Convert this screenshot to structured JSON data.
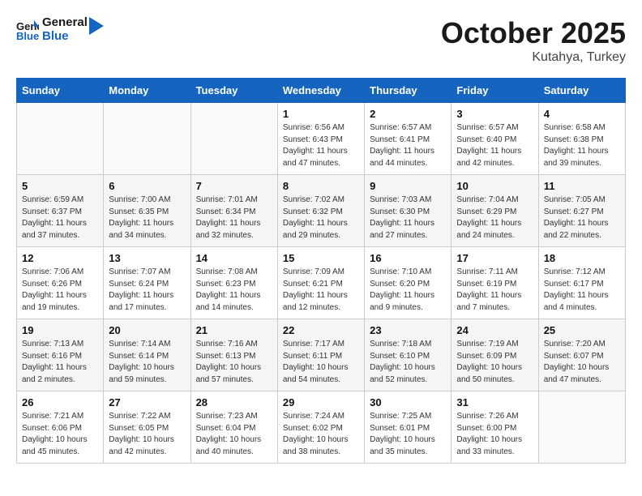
{
  "header": {
    "logo_line1": "General",
    "logo_line2": "Blue",
    "month": "October 2025",
    "location": "Kutahya, Turkey"
  },
  "weekdays": [
    "Sunday",
    "Monday",
    "Tuesday",
    "Wednesday",
    "Thursday",
    "Friday",
    "Saturday"
  ],
  "weeks": [
    [
      {
        "day": "",
        "info": ""
      },
      {
        "day": "",
        "info": ""
      },
      {
        "day": "",
        "info": ""
      },
      {
        "day": "1",
        "info": "Sunrise: 6:56 AM\nSunset: 6:43 PM\nDaylight: 11 hours\nand 47 minutes."
      },
      {
        "day": "2",
        "info": "Sunrise: 6:57 AM\nSunset: 6:41 PM\nDaylight: 11 hours\nand 44 minutes."
      },
      {
        "day": "3",
        "info": "Sunrise: 6:57 AM\nSunset: 6:40 PM\nDaylight: 11 hours\nand 42 minutes."
      },
      {
        "day": "4",
        "info": "Sunrise: 6:58 AM\nSunset: 6:38 PM\nDaylight: 11 hours\nand 39 minutes."
      }
    ],
    [
      {
        "day": "5",
        "info": "Sunrise: 6:59 AM\nSunset: 6:37 PM\nDaylight: 11 hours\nand 37 minutes."
      },
      {
        "day": "6",
        "info": "Sunrise: 7:00 AM\nSunset: 6:35 PM\nDaylight: 11 hours\nand 34 minutes."
      },
      {
        "day": "7",
        "info": "Sunrise: 7:01 AM\nSunset: 6:34 PM\nDaylight: 11 hours\nand 32 minutes."
      },
      {
        "day": "8",
        "info": "Sunrise: 7:02 AM\nSunset: 6:32 PM\nDaylight: 11 hours\nand 29 minutes."
      },
      {
        "day": "9",
        "info": "Sunrise: 7:03 AM\nSunset: 6:30 PM\nDaylight: 11 hours\nand 27 minutes."
      },
      {
        "day": "10",
        "info": "Sunrise: 7:04 AM\nSunset: 6:29 PM\nDaylight: 11 hours\nand 24 minutes."
      },
      {
        "day": "11",
        "info": "Sunrise: 7:05 AM\nSunset: 6:27 PM\nDaylight: 11 hours\nand 22 minutes."
      }
    ],
    [
      {
        "day": "12",
        "info": "Sunrise: 7:06 AM\nSunset: 6:26 PM\nDaylight: 11 hours\nand 19 minutes."
      },
      {
        "day": "13",
        "info": "Sunrise: 7:07 AM\nSunset: 6:24 PM\nDaylight: 11 hours\nand 17 minutes."
      },
      {
        "day": "14",
        "info": "Sunrise: 7:08 AM\nSunset: 6:23 PM\nDaylight: 11 hours\nand 14 minutes."
      },
      {
        "day": "15",
        "info": "Sunrise: 7:09 AM\nSunset: 6:21 PM\nDaylight: 11 hours\nand 12 minutes."
      },
      {
        "day": "16",
        "info": "Sunrise: 7:10 AM\nSunset: 6:20 PM\nDaylight: 11 hours\nand 9 minutes."
      },
      {
        "day": "17",
        "info": "Sunrise: 7:11 AM\nSunset: 6:19 PM\nDaylight: 11 hours\nand 7 minutes."
      },
      {
        "day": "18",
        "info": "Sunrise: 7:12 AM\nSunset: 6:17 PM\nDaylight: 11 hours\nand 4 minutes."
      }
    ],
    [
      {
        "day": "19",
        "info": "Sunrise: 7:13 AM\nSunset: 6:16 PM\nDaylight: 11 hours\nand 2 minutes."
      },
      {
        "day": "20",
        "info": "Sunrise: 7:14 AM\nSunset: 6:14 PM\nDaylight: 10 hours\nand 59 minutes."
      },
      {
        "day": "21",
        "info": "Sunrise: 7:16 AM\nSunset: 6:13 PM\nDaylight: 10 hours\nand 57 minutes."
      },
      {
        "day": "22",
        "info": "Sunrise: 7:17 AM\nSunset: 6:11 PM\nDaylight: 10 hours\nand 54 minutes."
      },
      {
        "day": "23",
        "info": "Sunrise: 7:18 AM\nSunset: 6:10 PM\nDaylight: 10 hours\nand 52 minutes."
      },
      {
        "day": "24",
        "info": "Sunrise: 7:19 AM\nSunset: 6:09 PM\nDaylight: 10 hours\nand 50 minutes."
      },
      {
        "day": "25",
        "info": "Sunrise: 7:20 AM\nSunset: 6:07 PM\nDaylight: 10 hours\nand 47 minutes."
      }
    ],
    [
      {
        "day": "26",
        "info": "Sunrise: 7:21 AM\nSunset: 6:06 PM\nDaylight: 10 hours\nand 45 minutes."
      },
      {
        "day": "27",
        "info": "Sunrise: 7:22 AM\nSunset: 6:05 PM\nDaylight: 10 hours\nand 42 minutes."
      },
      {
        "day": "28",
        "info": "Sunrise: 7:23 AM\nSunset: 6:04 PM\nDaylight: 10 hours\nand 40 minutes."
      },
      {
        "day": "29",
        "info": "Sunrise: 7:24 AM\nSunset: 6:02 PM\nDaylight: 10 hours\nand 38 minutes."
      },
      {
        "day": "30",
        "info": "Sunrise: 7:25 AM\nSunset: 6:01 PM\nDaylight: 10 hours\nand 35 minutes."
      },
      {
        "day": "31",
        "info": "Sunrise: 7:26 AM\nSunset: 6:00 PM\nDaylight: 10 hours\nand 33 minutes."
      },
      {
        "day": "",
        "info": ""
      }
    ]
  ]
}
